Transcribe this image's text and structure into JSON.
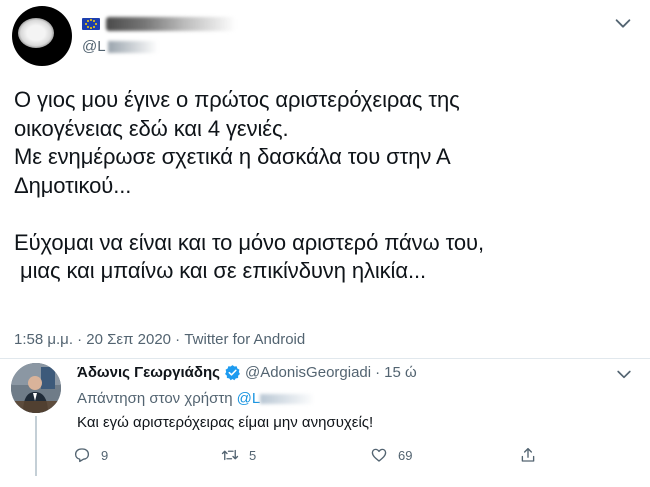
{
  "main_tweet": {
    "handle_prefix": "@L",
    "text": "Ο γιος μου έγινε ο πρώτος αριστερόχειρας της\nοικογένειας εδώ και 4 γενιές.\nΜε ενημέρωσε σχετικά η δασκάλα του στην Α\nΔημοτικού...\n\nΕύχομαι να είναι και το μόνο αριστερό πάνω του,\n μιας και μπαίνω και σε επικίνδυνη ηλικία...",
    "meta": "1:58 μ.μ. · 20 Σεπ 2020 · Twitter for Android"
  },
  "reply": {
    "name": "Άδωνις Γεωργιάδης",
    "handle": "@AdonisGeorgiadi",
    "dot": "·",
    "time": "15 ώ",
    "replying_to_label": "Απάντηση στον χρήστη",
    "replying_to_mention": "@L",
    "text": "Και εγώ αριστερόχειρας είμαι μην ανησυχείς!",
    "actions": {
      "replies": "9",
      "retweets": "5",
      "likes": "69"
    }
  },
  "colors": {
    "text": "#0f1419",
    "secondary": "#536471",
    "link": "#1b95e0",
    "verified": "#1d9bf0",
    "divider": "#e1e8ed"
  },
  "icons": [
    "chevron-down-icon",
    "verified-badge-icon",
    "reply-icon",
    "retweet-icon",
    "like-icon",
    "share-icon"
  ]
}
